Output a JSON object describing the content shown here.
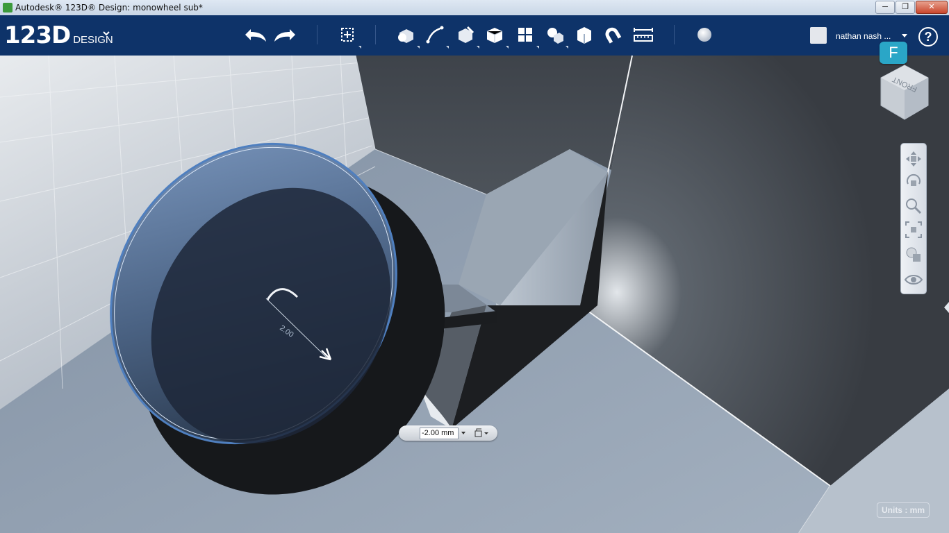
{
  "window": {
    "title": "Autodesk® 123D® Design: monowheel sub*",
    "minimize_label": "─",
    "maximize_label": "❐",
    "close_label": "✕"
  },
  "app": {
    "logo_number": "123D",
    "logo_word": "DESIGN"
  },
  "toolbar": {
    "tools": [
      "undo",
      "redo",
      "transform",
      "primitives",
      "sketch",
      "construct",
      "modify",
      "pattern",
      "grouping",
      "combine",
      "measure-snap",
      "snap",
      "measure",
      "material"
    ]
  },
  "user": {
    "name": "nathan nash ...",
    "help_label": "?"
  },
  "badge": {
    "label": "F"
  },
  "viewcube": {
    "face_label": "FRONT"
  },
  "dimension": {
    "value": "-2.00 mm",
    "arc_label": "2.00"
  },
  "navbar": {
    "buttons": [
      "pan",
      "orbit",
      "zoom",
      "fit",
      "view-mode",
      "visibility"
    ]
  },
  "units": {
    "label": "Units : mm"
  },
  "colors": {
    "toolbar_bg": "#0e3369",
    "accent": "#2aa6c7",
    "selection": "#6a8fc2"
  }
}
